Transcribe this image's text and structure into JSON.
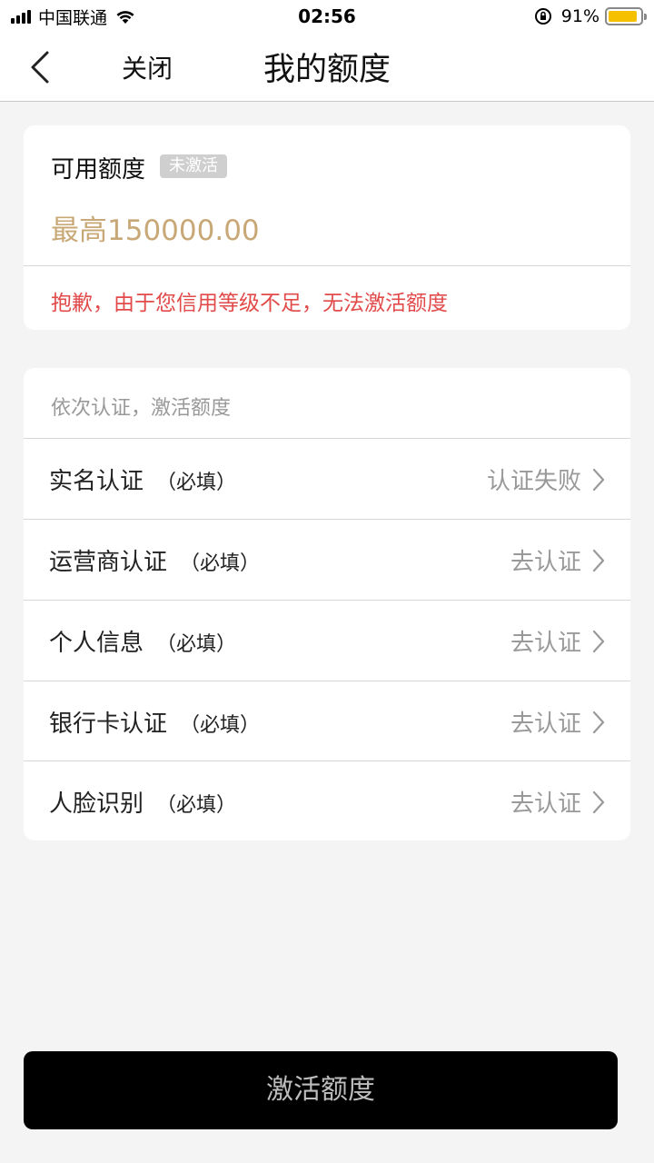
{
  "status_bar": {
    "carrier": "中国联通",
    "time": "02:56",
    "battery_percent": "91%",
    "battery_level": 0.91,
    "battery_color": "#f5c000"
  },
  "nav": {
    "close_label": "关闭",
    "title": "我的额度"
  },
  "quota_card": {
    "label": "可用额度",
    "badge": "未激活",
    "amount": "最高150000.00",
    "amount_color": "#c8a876",
    "error": "抱歉，由于您信用等级不足，无法激活额度",
    "error_color": "#e24a4a"
  },
  "steps_card": {
    "hint": "依次认证，激活额度",
    "items": [
      {
        "label": "实名认证",
        "required": "（必填）",
        "status": "认证失败"
      },
      {
        "label": "运营商认证",
        "required": "（必填）",
        "status": "去认证"
      },
      {
        "label": "个人信息",
        "required": "（必填）",
        "status": "去认证"
      },
      {
        "label": "银行卡认证",
        "required": "（必填）",
        "status": "去认证"
      },
      {
        "label": "人脸识别",
        "required": "（必填）",
        "status": "去认证"
      }
    ]
  },
  "activate_button": {
    "label": "激活额度"
  },
  "icons": {
    "back": "back-chevron-icon",
    "row_arrow": "chevron-right-icon",
    "wifi": "wifi-icon",
    "orientation_lock": "orientation-lock-icon",
    "battery": "battery-icon",
    "signal": "signal-icon"
  }
}
